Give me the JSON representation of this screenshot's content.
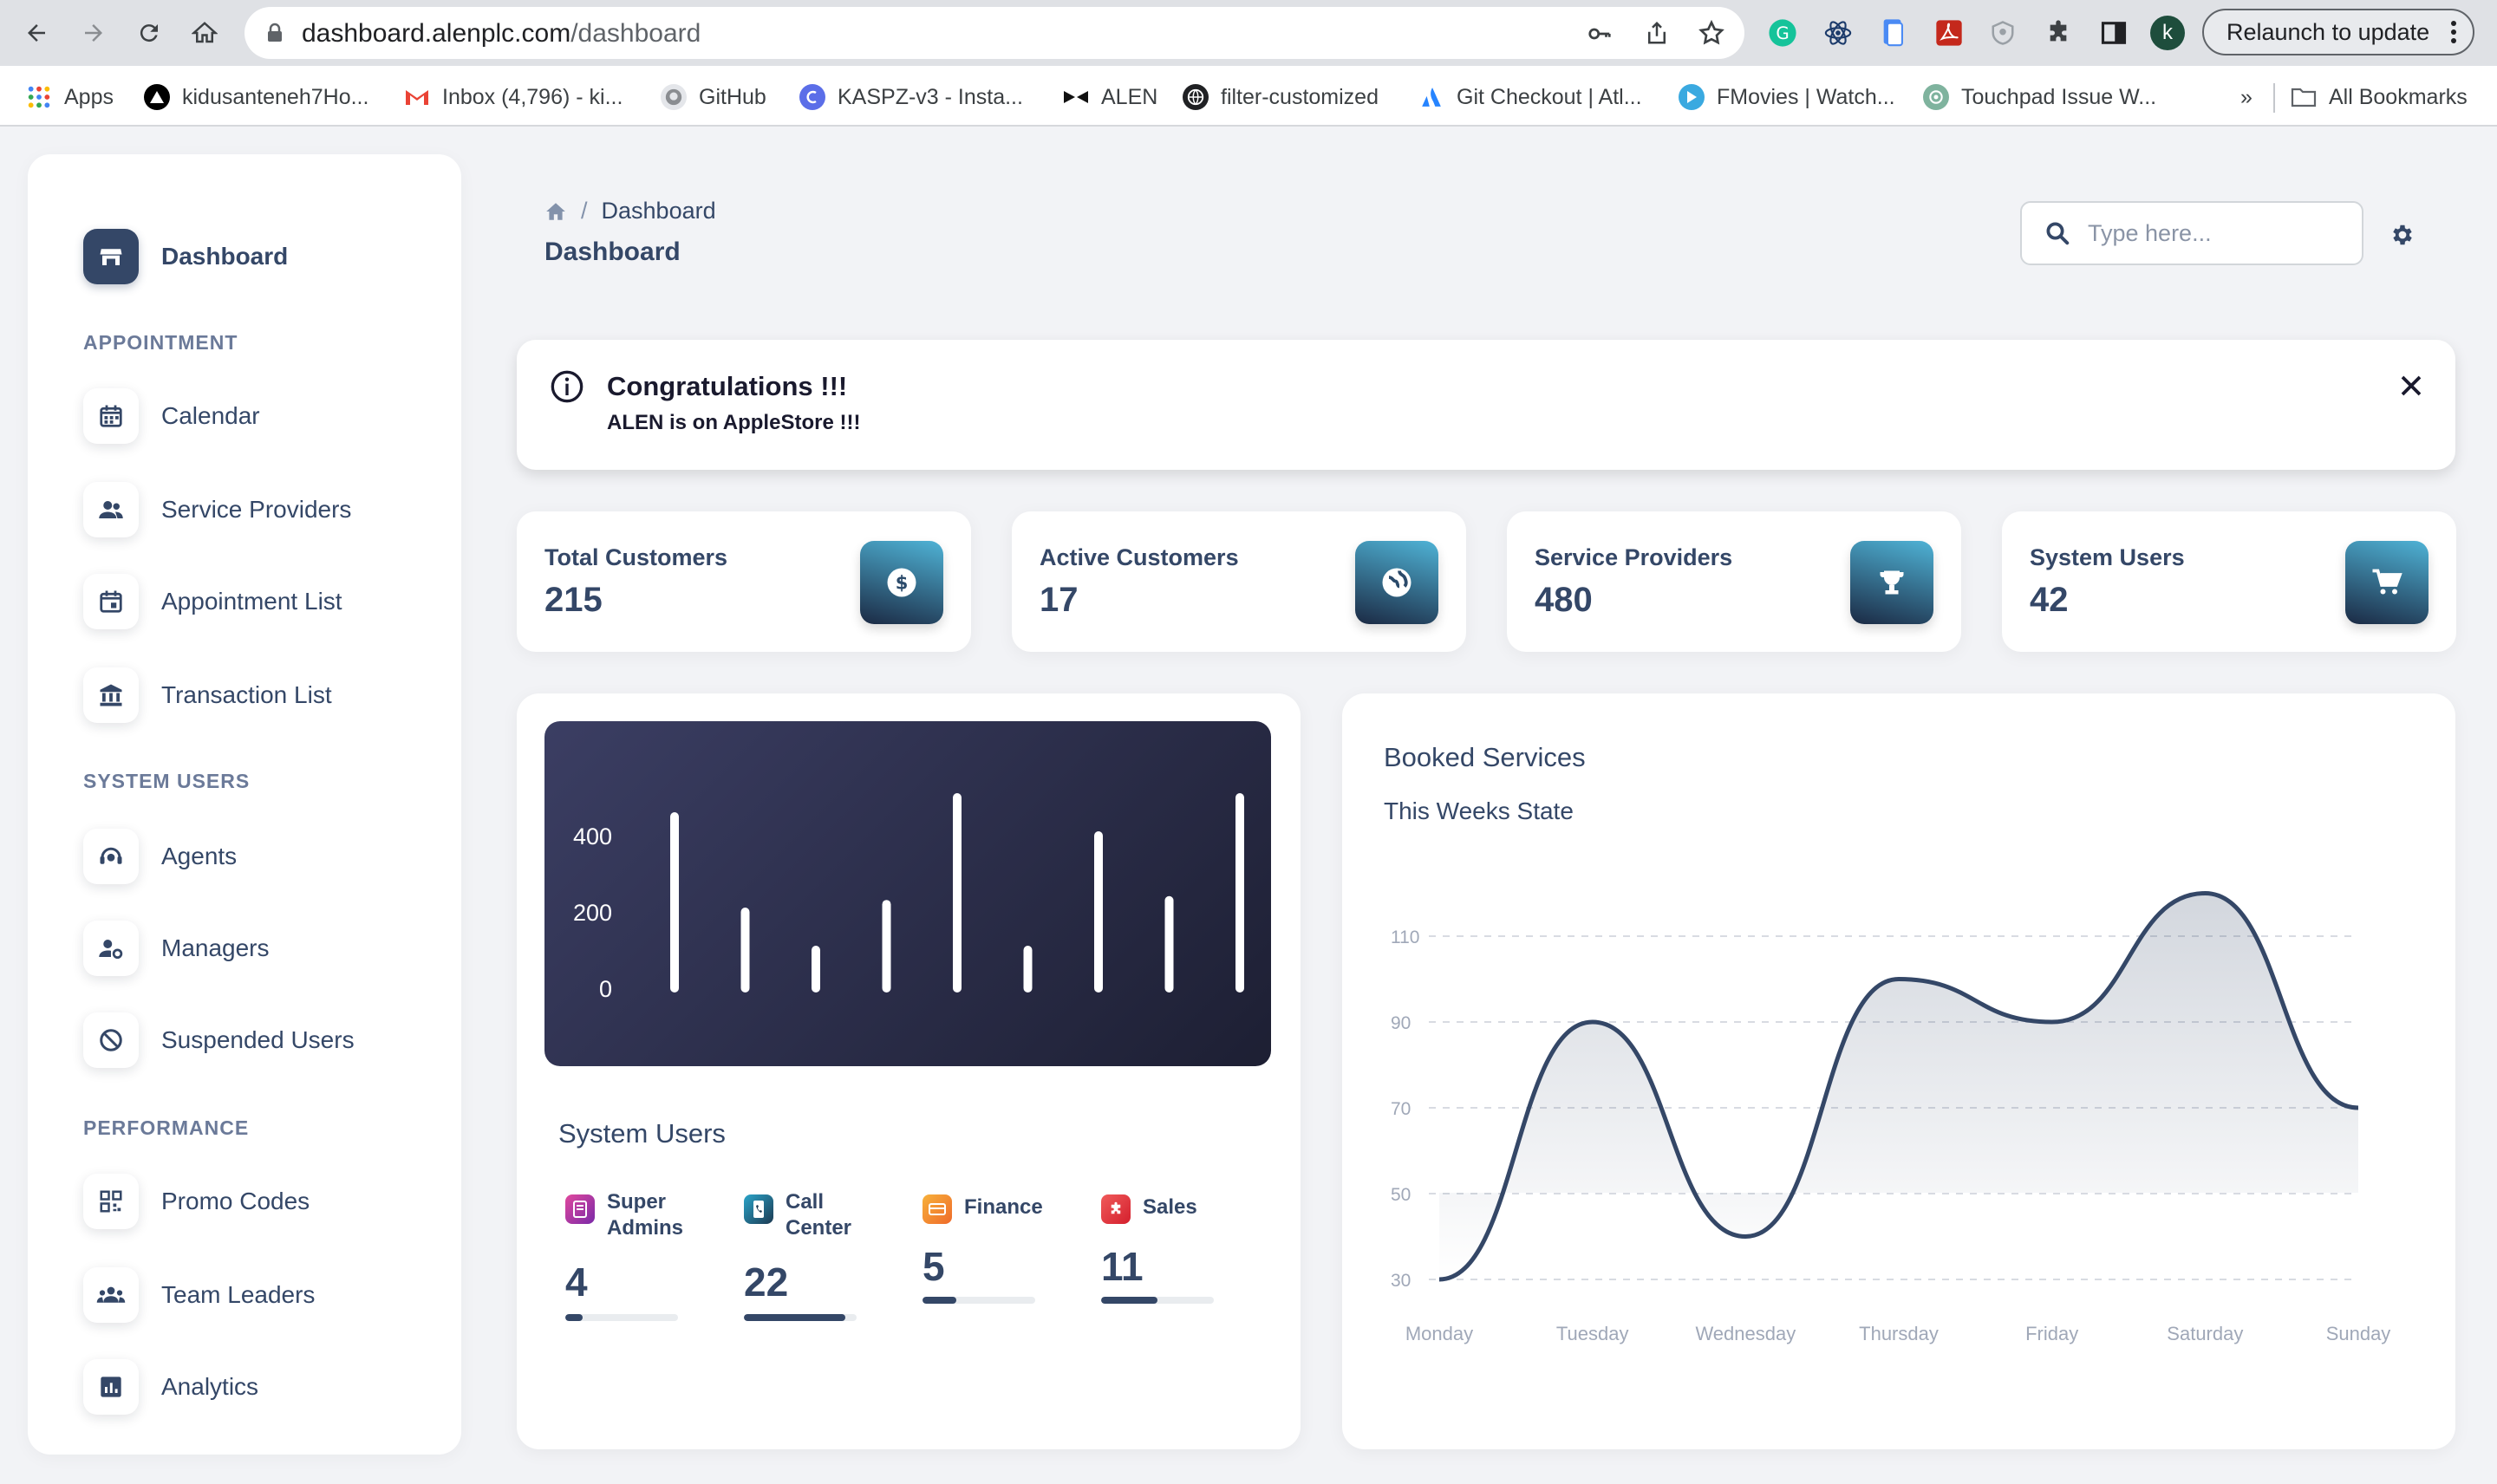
{
  "browser": {
    "url_host": "dashboard.alenplc.com",
    "url_path": "/dashboard",
    "relaunch_label": "Relaunch to update",
    "profile_initial": "k",
    "bookmarks": [
      {
        "label": "Apps",
        "icon": "apps-grid-icon"
      },
      {
        "label": "kidusanteneh7Ho...",
        "icon": "triangle-logo-icon"
      },
      {
        "label": "Inbox (4,796) - ki...",
        "icon": "gmail-icon"
      },
      {
        "label": "GitHub",
        "icon": "github-icon"
      },
      {
        "label": "KASPZ-v3 - Insta...",
        "icon": "instacart-icon"
      },
      {
        "label": "ALEN",
        "icon": "alen-logo-icon"
      },
      {
        "label": "filter-customized",
        "icon": "globe-icon"
      },
      {
        "label": "Git Checkout | Atl...",
        "icon": "atlassian-icon"
      },
      {
        "label": "FMovies | Watch...",
        "icon": "play-icon"
      },
      {
        "label": "Touchpad Issue W...",
        "icon": "openai-icon"
      }
    ],
    "more_label": "»",
    "all_bookmarks_label": "All Bookmarks"
  },
  "sidebar": {
    "dashboard_label": "Dashboard",
    "sections": [
      {
        "title": "APPOINTMENT",
        "items": [
          {
            "label": "Calendar",
            "icon": "calendar-icon"
          },
          {
            "label": "Service Providers",
            "icon": "people-icon"
          },
          {
            "label": "Appointment List",
            "icon": "event-icon"
          },
          {
            "label": "Transaction List",
            "icon": "bank-icon"
          }
        ]
      },
      {
        "title": "SYSTEM USERS",
        "items": [
          {
            "label": "Agents",
            "icon": "support-agent-icon"
          },
          {
            "label": "Managers",
            "icon": "manage-accounts-icon"
          },
          {
            "label": "Suspended Users",
            "icon": "block-icon"
          }
        ]
      },
      {
        "title": "PERFORMANCE",
        "items": [
          {
            "label": "Promo Codes",
            "icon": "qr-code-icon"
          },
          {
            "label": "Team Leaders",
            "icon": "groups-icon"
          },
          {
            "label": "Analytics",
            "icon": "analytics-icon"
          }
        ]
      }
    ]
  },
  "header": {
    "breadcrumb": "Dashboard",
    "breadcrumb_sep": "/",
    "title": "Dashboard",
    "search_placeholder": "Type here..."
  },
  "alert": {
    "title": "Congratulations !!!",
    "message": "ALEN is on AppleStore !!!"
  },
  "stats": [
    {
      "label": "Total Customers",
      "value": "215",
      "icon": "dollar-icon"
    },
    {
      "label": "Active Customers",
      "value": "17",
      "icon": "globe-icon"
    },
    {
      "label": "Service Providers",
      "value": "480",
      "icon": "trophy-icon"
    },
    {
      "label": "System Users",
      "value": "42",
      "icon": "cart-icon"
    }
  ],
  "system_users": {
    "title": "System Users",
    "items": [
      {
        "label_line1": "Super",
        "label_line2": "Admins",
        "value": "4",
        "progress": 0.15,
        "color": "#c2308f"
      },
      {
        "label_line1": "Call",
        "label_line2": "Center",
        "value": "22",
        "progress": 0.9,
        "color": "#1b6f88"
      },
      {
        "label_line1": "Finance",
        "label_line2": "",
        "value": "5",
        "progress": 0.3,
        "color": "#f08a24"
      },
      {
        "label_line1": "Sales",
        "label_line2": "",
        "value": "11",
        "progress": 0.5,
        "color": "#e5333a"
      }
    ]
  },
  "chart_data": [
    {
      "type": "bar",
      "title": "",
      "ylim": [
        0,
        500
      ],
      "yticks": [
        "0",
        "200",
        "400"
      ],
      "values": [
        450,
        200,
        100,
        220,
        500,
        100,
        400,
        230,
        500
      ],
      "grid": false
    },
    {
      "type": "area",
      "title": "Booked Services",
      "subtitle": "This Weeks State",
      "categories": [
        "Monday",
        "Tuesday",
        "Wednesday",
        "Thursday",
        "Friday",
        "Saturday",
        "Sunday"
      ],
      "values": [
        30,
        90,
        40,
        100,
        90,
        120,
        70
      ],
      "ylim": [
        30,
        110
      ],
      "yticks": [
        "30",
        "50",
        "70",
        "90",
        "110"
      ],
      "grid": true,
      "color": "#344767"
    }
  ]
}
